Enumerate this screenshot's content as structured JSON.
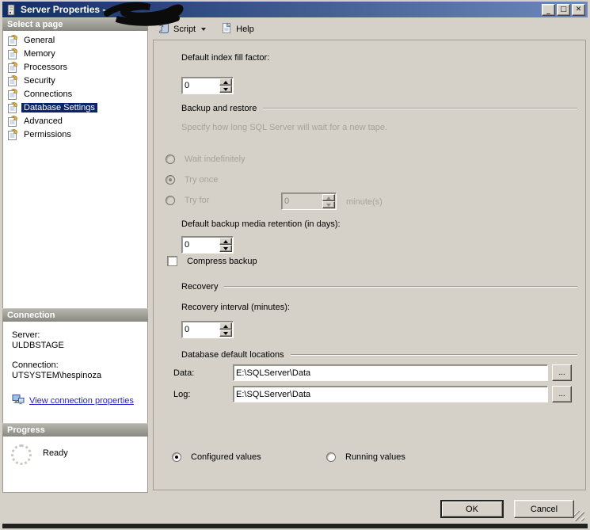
{
  "window": {
    "title": "Server Properties -",
    "minimize_glyph": "_",
    "maximize_glyph": "□",
    "close_glyph": "✕"
  },
  "toolbar": {
    "script_label": "Script",
    "help_label": "Help"
  },
  "sidebar": {
    "select_page_header": "Select a page",
    "pages": [
      {
        "label": "General",
        "selected": false
      },
      {
        "label": "Memory",
        "selected": false
      },
      {
        "label": "Processors",
        "selected": false
      },
      {
        "label": "Security",
        "selected": false
      },
      {
        "label": "Connections",
        "selected": false
      },
      {
        "label": "Database Settings",
        "selected": true
      },
      {
        "label": "Advanced",
        "selected": false
      },
      {
        "label": "Permissions",
        "selected": false
      }
    ],
    "connection_header": "Connection",
    "server_label": "Server:",
    "server_value": "ULDBSTAGE",
    "connection_label": "Connection:",
    "connection_value": "UTSYSTEM\\hespinoza",
    "view_link": "View connection properties",
    "progress_header": "Progress",
    "progress_status": "Ready"
  },
  "main": {
    "fill_factor_label": "Default index fill factor:",
    "fill_factor_value": "0",
    "backup_group_label": "Backup and restore",
    "backup_hint": "Specify how long SQL Server will wait for a new tape.",
    "wait_label": "Wait indefinitely",
    "wait_checked": false,
    "try_once_label": "Try once",
    "try_once_checked": true,
    "try_for_label": "Try for",
    "try_for_checked": false,
    "try_for_value": "0",
    "minutes_label": "minute(s)",
    "retention_label": "Default backup media retention (in days):",
    "retention_value": "0",
    "compress_label": "Compress backup",
    "compress_checked": false,
    "recovery_group_label": "Recovery",
    "recovery_interval_label": "Recovery interval (minutes):",
    "recovery_interval_value": "0",
    "locations_group_label": "Database default locations",
    "data_label": "Data:",
    "data_value": "E:\\SQLServer\\Data",
    "log_label": "Log:",
    "log_value": "E:\\SQLServer\\Data",
    "browse_label": "...",
    "configured_label": "Configured values",
    "configured_checked": true,
    "running_label": "Running values",
    "running_checked": false
  },
  "footer": {
    "ok_label": "OK",
    "cancel_label": "Cancel"
  },
  "colors": {
    "titlebar_left": "#122e66",
    "titlebar_right": "#6f88bb",
    "selected_bg": "#0a246a",
    "link": "#2424cc",
    "header_gray": "#8a8981"
  }
}
